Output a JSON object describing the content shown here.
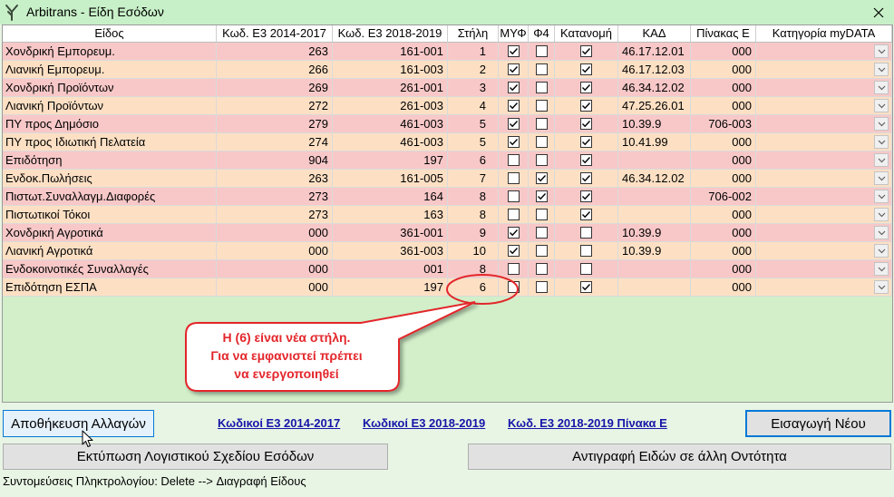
{
  "window": {
    "title": "Arbitrans - Είδη Εσόδων",
    "logo_icon": "app-logo-icon",
    "close_icon": "close-icon"
  },
  "grid": {
    "columns": [
      "Είδος",
      "Κωδ. Ε3 2014-2017",
      "Κωδ. Ε3 2018-2019",
      "Στήλη",
      "ΜΥΦ",
      "Φ4",
      "Κατανομή",
      "ΚΑΔ",
      "Πίνακας Ε",
      "Κατηγορία myDATA"
    ],
    "dropdown_icon": "chevron-down-icon",
    "rows": [
      {
        "name": "Χονδρική Εμπορευμ.",
        "e3_2014": "263",
        "e3_2018": "161-001",
        "column": "1",
        "myf": true,
        "f4": false,
        "allocation": true,
        "kad": "46.17.12.01",
        "table_e": "000"
      },
      {
        "name": "Λιανική Εμπορευμ.",
        "e3_2014": "266",
        "e3_2018": "161-003",
        "column": "2",
        "myf": true,
        "f4": false,
        "allocation": true,
        "kad": "46.17.12.03",
        "table_e": "000"
      },
      {
        "name": "Χονδρική Προϊόντων",
        "e3_2014": "269",
        "e3_2018": "261-001",
        "column": "3",
        "myf": true,
        "f4": false,
        "allocation": true,
        "kad": "46.34.12.02",
        "table_e": "000"
      },
      {
        "name": "Λιανική Προϊόντων",
        "e3_2014": "272",
        "e3_2018": "261-003",
        "column": "4",
        "myf": true,
        "f4": false,
        "allocation": true,
        "kad": "47.25.26.01",
        "table_e": "000"
      },
      {
        "name": "ΠΥ προς Δημόσιο",
        "e3_2014": "279",
        "e3_2018": "461-003",
        "column": "5",
        "myf": true,
        "f4": false,
        "allocation": true,
        "kad": "10.39.9",
        "table_e": "706-003"
      },
      {
        "name": "ΠΥ προς Ιδιωτική Πελατεία",
        "e3_2014": "274",
        "e3_2018": "461-003",
        "column": "5",
        "myf": true,
        "f4": false,
        "allocation": true,
        "kad": "10.41.99",
        "table_e": "000"
      },
      {
        "name": "Επιδότηση",
        "e3_2014": "904",
        "e3_2018": "197",
        "column": "6",
        "myf": false,
        "f4": false,
        "allocation": true,
        "kad": "",
        "table_e": "000"
      },
      {
        "name": "Ενδοκ.Πωλήσεις",
        "e3_2014": "263",
        "e3_2018": "161-005",
        "column": "7",
        "myf": false,
        "f4": true,
        "allocation": true,
        "kad": "46.34.12.02",
        "table_e": "000"
      },
      {
        "name": "Πιστωτ.Συναλλαγμ.Διαφορές",
        "e3_2014": "273",
        "e3_2018": "164",
        "column": "8",
        "myf": false,
        "f4": true,
        "allocation": true,
        "kad": "",
        "table_e": "706-002"
      },
      {
        "name": "Πιστωτικοί Τόκοι",
        "e3_2014": "273",
        "e3_2018": "163",
        "column": "8",
        "myf": false,
        "f4": false,
        "allocation": true,
        "kad": "",
        "table_e": "000"
      },
      {
        "name": "Χονδρική Αγροτικά",
        "e3_2014": "000",
        "e3_2018": "361-001",
        "column": "9",
        "myf": true,
        "f4": false,
        "allocation": false,
        "kad": "10.39.9",
        "table_e": "000"
      },
      {
        "name": "Λιανική Αγροτικά",
        "e3_2014": "000",
        "e3_2018": "361-003",
        "column": "10",
        "myf": true,
        "f4": false,
        "allocation": false,
        "kad": "10.39.9",
        "table_e": "000"
      },
      {
        "name": "Ενδοκοινοτικές Συναλλαγές",
        "e3_2014": "000",
        "e3_2018": "001",
        "column": "8",
        "myf": false,
        "f4": false,
        "allocation": false,
        "kad": "",
        "table_e": "000"
      },
      {
        "name": "Επιδότηση ΕΣΠΑ",
        "e3_2014": "000",
        "e3_2018": "197",
        "column": "6",
        "myf": false,
        "f4": false,
        "allocation": true,
        "kad": "",
        "table_e": "000"
      }
    ]
  },
  "annotation": {
    "lines": [
      "Η (6) είναι νέα στήλη.",
      "Για να εμφανιστεί πρέπει",
      "να ενεργοποιηθεί"
    ]
  },
  "buttons": {
    "save": "Αποθήκευση Αλλαγών",
    "insert_new": "Εισαγωγή Νέου",
    "print": "Εκτύπωση Λογιστικού Σχεδίου Εσόδων",
    "copy": "Αντιγραφή Ειδών σε άλλη Οντότητα"
  },
  "links": {
    "e3_2014": "Κωδικοί Ε3 2014-2017",
    "e3_2018": "Κωδικοί Ε3 2018-2019",
    "e3_2018_table_e": "Κωδ. Ε3 2018-2019 Πίνακα Ε"
  },
  "status_bar": {
    "shortcuts": "Συντομεύσεις Πληκτρολογίου: Delete --> Διαγραφή Είδους"
  },
  "cursor_icon": "mouse-cursor-icon",
  "colors": {
    "title_bar": "#c8f0c8",
    "form_background": "#e8f5e4",
    "grid_background": "#d2efc9",
    "row_odd": "#f8c8c8",
    "row_even": "#fde0c4",
    "annotation_red": "#e3262b",
    "link": "#1515a8",
    "focus_border": "#0078d7"
  }
}
